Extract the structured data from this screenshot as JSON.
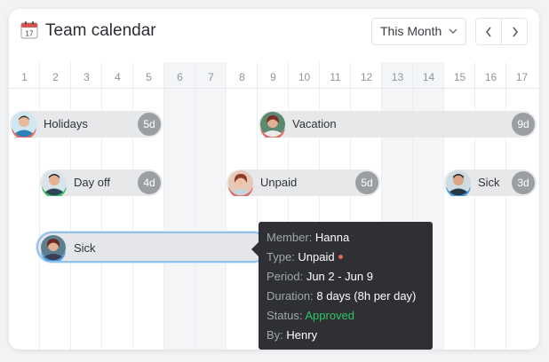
{
  "header": {
    "title": "Team calendar",
    "calendar_icon_day": "17",
    "range_select_value": "This Month",
    "prev_icon": "chevron-left-icon",
    "next_icon": "chevron-right-icon"
  },
  "days": [
    "1",
    "2",
    "3",
    "4",
    "5",
    "6",
    "7",
    "8",
    "9",
    "10",
    "11",
    "12",
    "13",
    "14",
    "15",
    "16",
    "17"
  ],
  "weekend_days": [
    "6",
    "7",
    "13",
    "14"
  ],
  "events": [
    {
      "label": "Holidays",
      "duration": "5d",
      "status_color": "#e56a5e"
    },
    {
      "label": "Vacation",
      "duration": "9d",
      "status_color": "#e56a5e"
    },
    {
      "label": "Day off",
      "duration": "4d",
      "status_color": "#3dbb6e"
    },
    {
      "label": "Unpaid",
      "duration": "5d",
      "status_color": "#e56a5e"
    },
    {
      "label": "Sick",
      "duration": "3d",
      "status_color": "#4a9be0"
    },
    {
      "label": "Sick",
      "duration": "",
      "status_color": "#4a9be0"
    }
  ],
  "tooltip": {
    "member_key": "Member:",
    "member_val": "Hanna",
    "type_key": "Type:",
    "type_val": "Unpaid",
    "period_key": "Period:",
    "period_val": "Jun 2 - Jun 9",
    "duration_key": "Duration:",
    "duration_val": "8 days (8h per day)",
    "status_key": "Status:",
    "status_val": "Approved",
    "by_key": "By:",
    "by_val": "Henry"
  },
  "colors": {
    "approved": "#2fc463",
    "unpaid_dot": "#e0675f",
    "selected_outline": "#8fc1ea"
  }
}
